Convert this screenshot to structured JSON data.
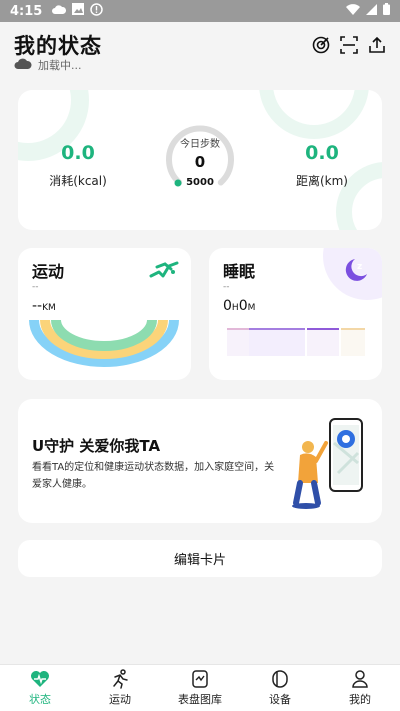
{
  "status_bar": {
    "time": "4:15"
  },
  "header": {
    "title": "我的状态",
    "subtitle": "加载中..."
  },
  "summary": {
    "consumption": {
      "value": "0.0",
      "label": "消耗(kcal)"
    },
    "steps": {
      "label": "今日步数",
      "value": "0",
      "goal": "5000",
      "progress": 0
    },
    "distance": {
      "value": "0.0",
      "label": "距离(km)"
    }
  },
  "sport_card": {
    "title": "运动",
    "dash": "--",
    "value": "--",
    "unit": "KM"
  },
  "sleep_card": {
    "title": "睡眠",
    "dash": "--",
    "hours": "0",
    "h_unit": "H",
    "minutes": "0",
    "m_unit": "M"
  },
  "promo": {
    "title": "U守护 关爱你我TA",
    "description": "看看TA的定位和健康运动状态数据，加入家庭空间，关爱家人健康。"
  },
  "edit_button": "编辑卡片",
  "nav": [
    {
      "label": "状态",
      "icon": "heart-icon",
      "active": true
    },
    {
      "label": "运动",
      "icon": "run-icon",
      "active": false
    },
    {
      "label": "表盘图库",
      "icon": "watchface-icon",
      "active": false
    },
    {
      "label": "设备",
      "icon": "device-icon",
      "active": false
    },
    {
      "label": "我的",
      "icon": "person-icon",
      "active": false
    }
  ],
  "colors": {
    "accent": "#1eb47e",
    "sleep": "#7b4fe0"
  }
}
